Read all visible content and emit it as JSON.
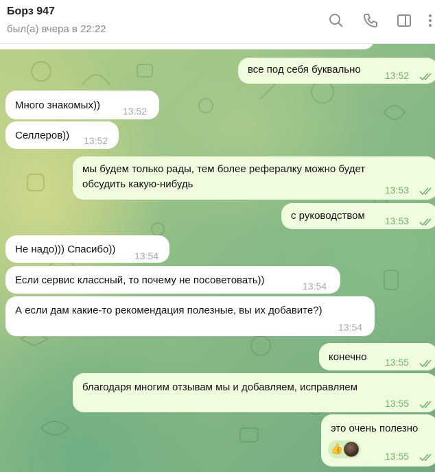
{
  "header": {
    "name": "Борз 947",
    "status": "был(а) вчера в 22:22",
    "icons": [
      "search-icon",
      "phone-icon",
      "sidebar-toggle-icon",
      "more-icon"
    ]
  },
  "messages": [
    {
      "dir": "out",
      "text": "все под себя буквально",
      "time": "13:52",
      "read": true
    },
    {
      "dir": "in",
      "text": "Много знакомых))",
      "time": "13:52"
    },
    {
      "dir": "in",
      "text": "Селлеров))",
      "time": "13:52"
    },
    {
      "dir": "out",
      "text": "мы будем только рады, тем более рефералку можно будет обсудить какую-нибудь",
      "time": "13:53",
      "read": true
    },
    {
      "dir": "out",
      "text": "с руководством",
      "time": "13:53",
      "read": true
    },
    {
      "dir": "in",
      "text": "Не надо))) Спасибо))",
      "time": "13:54"
    },
    {
      "dir": "in",
      "text": "Если сервис классный, то почему не посоветовать))",
      "time": "13:54"
    },
    {
      "dir": "in",
      "text": "А если дам какие-то рекомендация полезные, вы их добавите?)",
      "time": "13:54"
    },
    {
      "dir": "out",
      "text": "конечно",
      "time": "13:55",
      "read": true
    },
    {
      "dir": "out",
      "text": "благодаря многим отзывам мы и добавляем, исправляем",
      "time": "13:55",
      "read": true
    },
    {
      "dir": "out",
      "text": "это очень полезно",
      "time": "13:55",
      "read": true,
      "reaction": "👍"
    }
  ],
  "colors": {
    "incoming": "#ffffff",
    "outgoing": "#effdde",
    "read_check": "#6fb36b"
  }
}
